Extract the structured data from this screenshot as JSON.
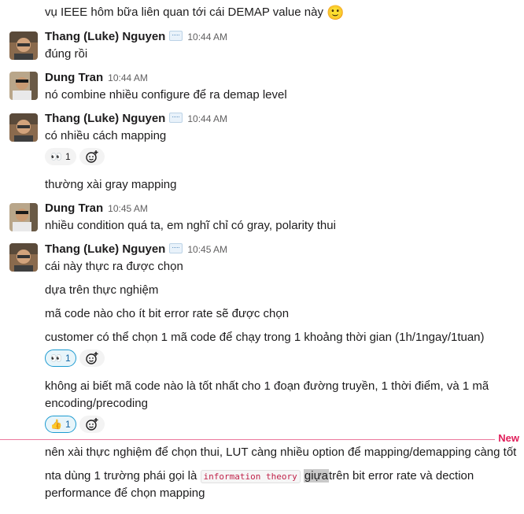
{
  "messages": {
    "m0": {
      "text": "vụ IEEE hôm bữa liên quan tới cái DEMAP value này",
      "emoji": "🙂"
    },
    "g1": {
      "author": "Thang (Luke) Nguyen",
      "time": "10:44 AM",
      "lines": [
        "đúng rồi"
      ]
    },
    "g2": {
      "author": "Dung Tran",
      "time": "10:44 AM",
      "lines": [
        "nó combine nhiều configure để ra demap level"
      ]
    },
    "g3": {
      "author": "Thang (Luke) Nguyen",
      "time": "10:44 AM",
      "lines": [
        "có nhiều cách mapping"
      ],
      "reaction": {
        "emoji": "👀",
        "count": "1"
      }
    },
    "g3b": {
      "text": "thường xài gray mapping"
    },
    "g4": {
      "author": "Dung Tran",
      "time": "10:45 AM",
      "lines": [
        "nhiều condition quá ta, em nghĩ chỉ có gray, polarity thui"
      ]
    },
    "g5": {
      "author": "Thang (Luke) Nguyen",
      "time": "10:45 AM",
      "lines": [
        "cái này thực ra được chọn",
        "dựa trên thực nghiệm",
        "mã code nào cho ít bit error rate sẽ được chọn",
        "customer có thể chọn 1 mã code để chạy trong 1 khoảng thời gian (1h/1ngay/1tuan)"
      ],
      "reaction1": {
        "emoji": "👀",
        "count": "1"
      },
      "line5a": "không ai biết mã code nào là tốt nhất cho 1 đoạn đường truyền, 1 thời điểm, và 1 mã",
      "line5b": "encoding/precoding",
      "reaction2": {
        "emoji": "👍",
        "count": "1"
      }
    },
    "divider_label": "New",
    "n1": "nên xài thực nghiệm để chọn thui, LUT càng nhiều option để mapping/demapping càng tốt",
    "n2": {
      "pre": "nta dùng 1 trường phái gọi là",
      "code": "information theory",
      "hl": "giựa",
      "post": "trên bit error rate và dection",
      "line2": "performance để chọn mapping"
    }
  },
  "colors": {
    "new_divider": "#e01e5a",
    "link_blue": "#1264a3"
  },
  "icons": {
    "status": "speech-bubble-icon",
    "add_reaction": "add-reaction-icon"
  }
}
